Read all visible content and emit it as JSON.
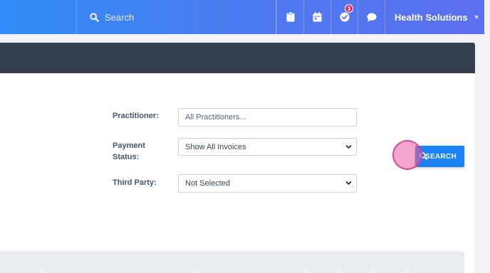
{
  "topbar": {
    "search_placeholder": "Search",
    "notification_count": "3",
    "brand": "Health Solutions"
  },
  "colors": {
    "topbar_start": "#2f8df6",
    "topbar_end": "#5b6ef0",
    "dark_band": "#363f4f",
    "primary_button": "#1d82f5",
    "badge": "#d6226b"
  },
  "filters": {
    "practitioner": {
      "label": "Practitioner:",
      "placeholder": "All Practitioners..."
    },
    "payment_status": {
      "label": "Payment Status:",
      "value": "Show All Invoices"
    },
    "third_party": {
      "label": "Third Party:",
      "value": "Not Selected"
    }
  },
  "actions": {
    "search_label": "SEARCH"
  }
}
